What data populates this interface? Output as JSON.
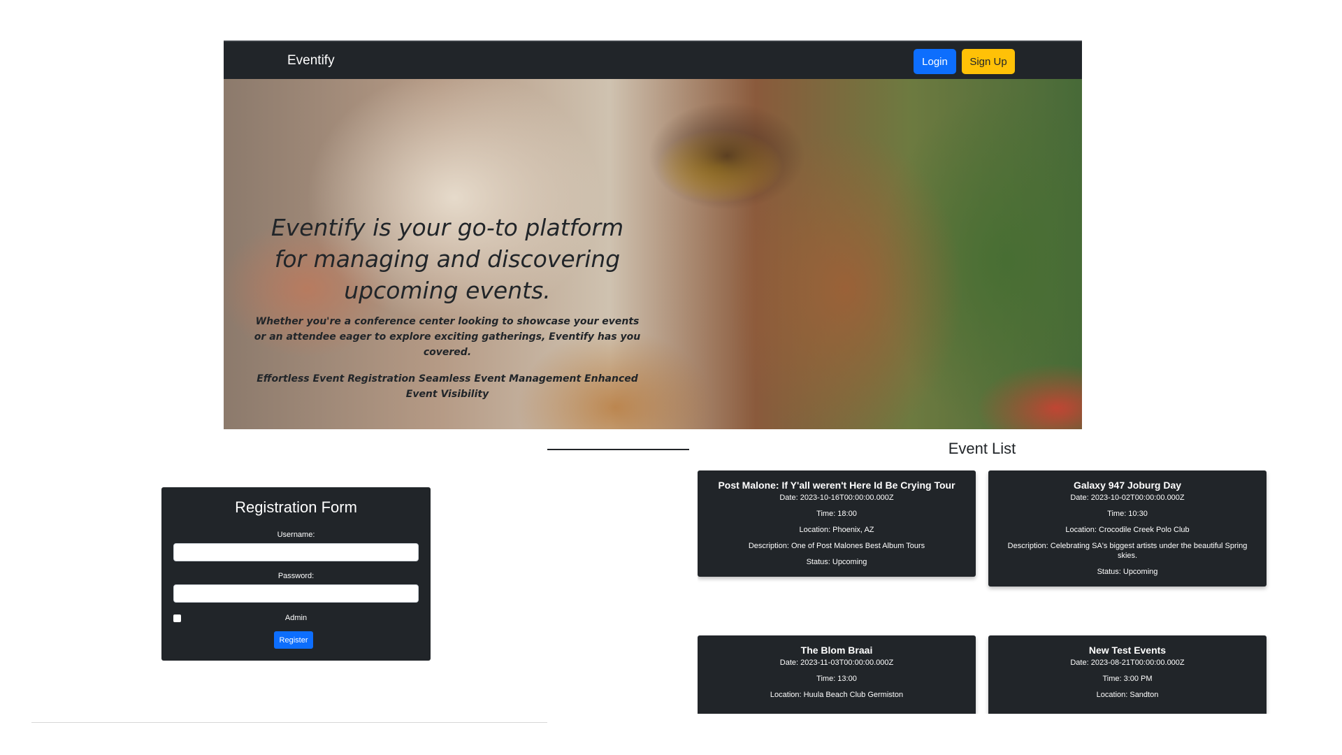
{
  "navbar": {
    "brand": "Eventify",
    "login_label": "Login",
    "signup_label": "Sign Up"
  },
  "hero": {
    "title": "Eventify is your go-to platform for managing and discovering upcoming events.",
    "subtitle": "Whether you're a conference center looking to showcase your events or an attendee eager to explore exciting gatherings, Eventify has you covered.",
    "features": "Effortless Event Registration Seamless Event Management Enhanced Event Visibility"
  },
  "registration": {
    "title": "Registration Form",
    "username_label": "Username:",
    "username_value": "",
    "password_label": "Password:",
    "password_value": "",
    "admin_label": "Admin",
    "admin_checked": false,
    "register_label": "Register"
  },
  "event_list": {
    "title": "Event List",
    "events": [
      {
        "name": "Post Malone: If Y'all weren't Here Id Be Crying Tour",
        "date": "Date: 2023-10-16T00:00:00.000Z",
        "time": "Time: 18:00",
        "location": "Location: Phoenix, AZ",
        "description": "Description: One of Post Malones Best Album Tours",
        "status": "Status: Upcoming"
      },
      {
        "name": "Galaxy 947 Joburg Day",
        "date": "Date: 2023-10-02T00:00:00.000Z",
        "time": "Time: 10:30",
        "location": "Location: Crocodile Creek Polo Club",
        "description": "Description: Celebrating SA's biggest artists under the beautiful Spring skies.",
        "status": "Status: Upcoming"
      },
      {
        "name": "The Blom Braai",
        "date": "Date: 2023-11-03T00:00:00.000Z",
        "time": "Time: 13:00",
        "location": "Location: Huula Beach Club Germiston"
      },
      {
        "name": "New Test Events",
        "date": "Date: 2023-08-21T00:00:00.000Z",
        "time": "Time: 3:00 PM",
        "location": "Location: Sandton"
      }
    ]
  }
}
